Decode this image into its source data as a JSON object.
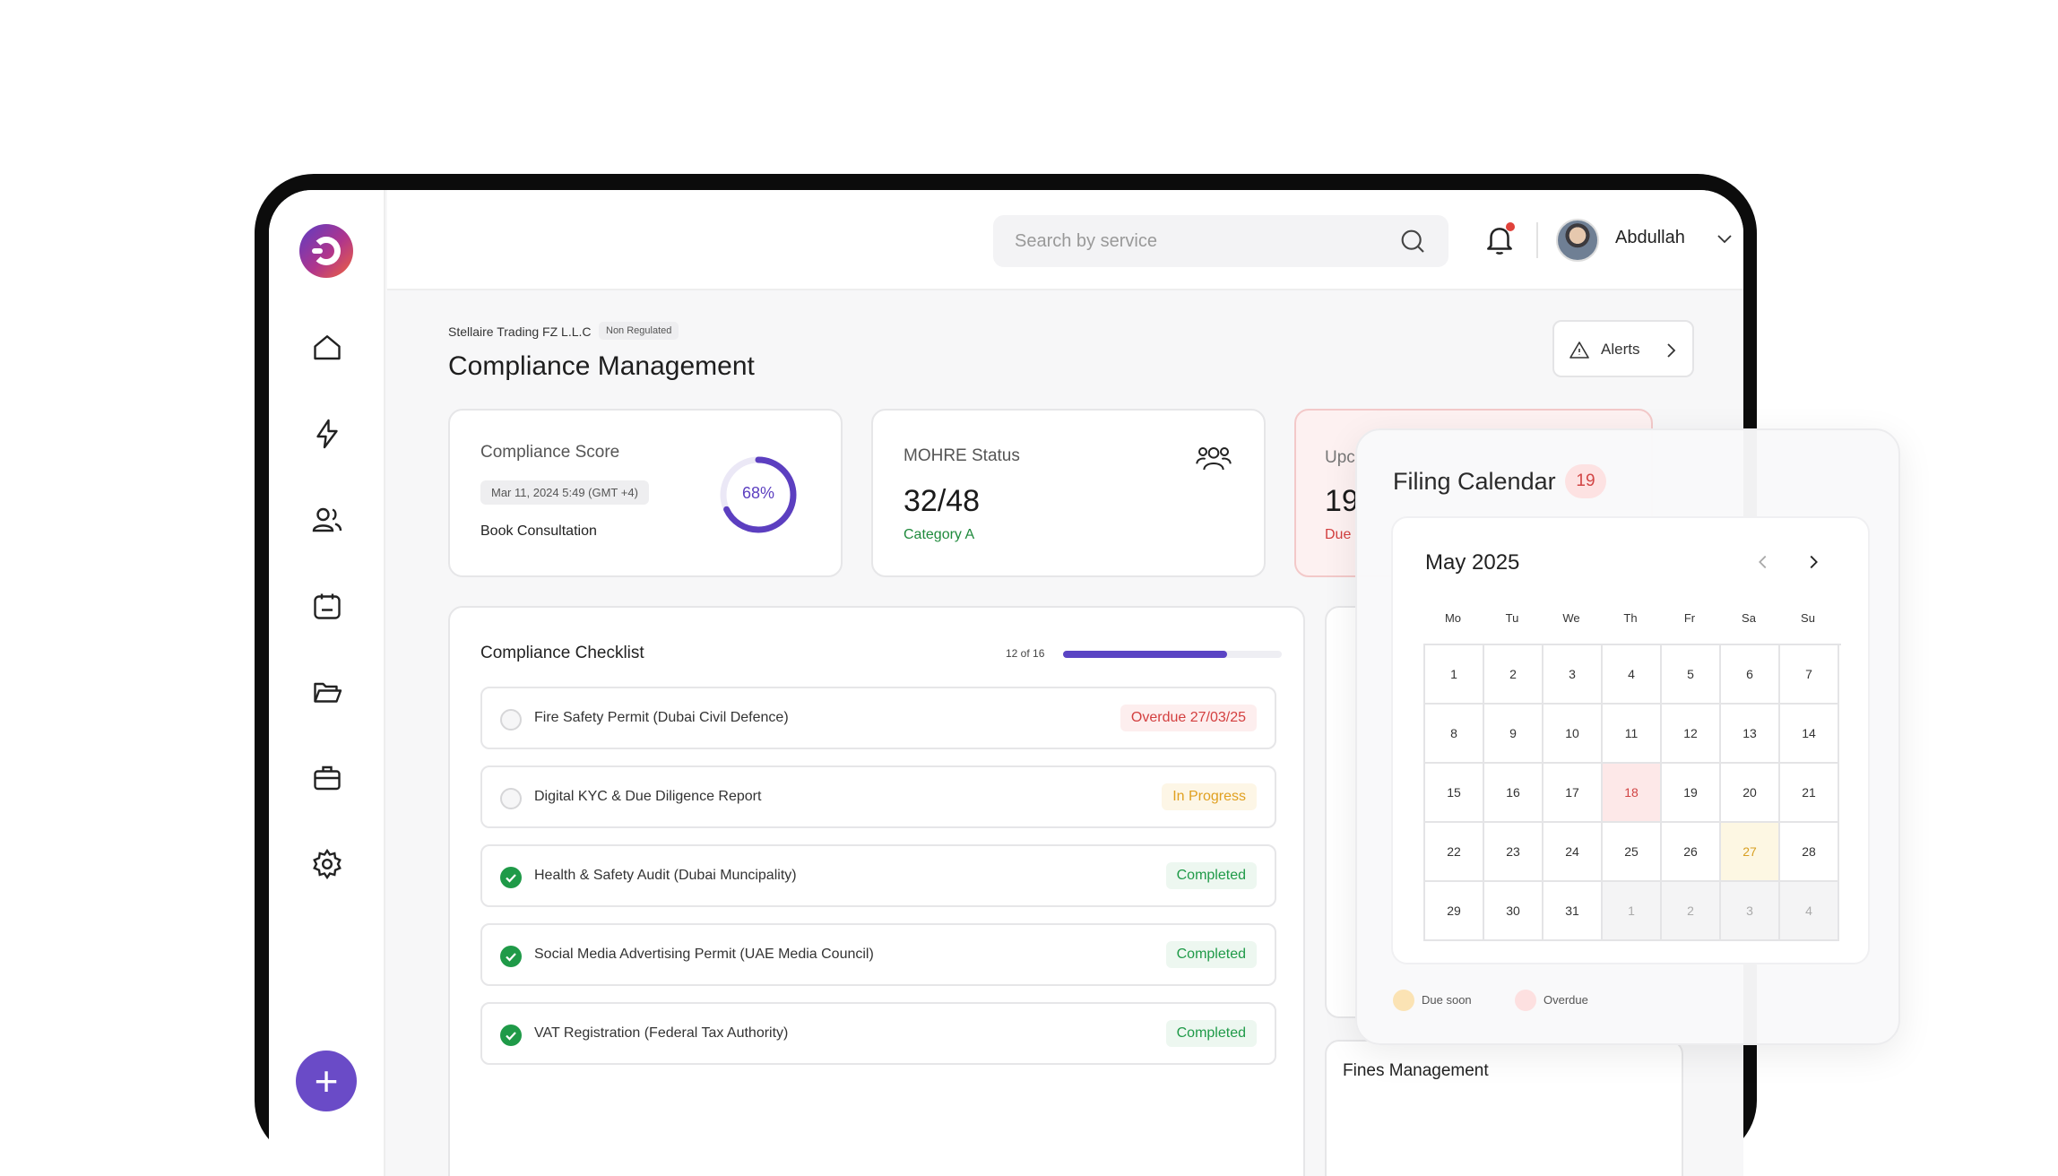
{
  "header": {
    "search_placeholder": "Search by service",
    "user_name": "Abdullah"
  },
  "page": {
    "company": "Stellaire Trading FZ L.L.C",
    "company_badge": "Non Regulated",
    "title": "Compliance Management",
    "alerts_label": "Alerts"
  },
  "score_card": {
    "label": "Compliance Score",
    "date": "Mar 11, 2024 5:49 (GMT +4)",
    "action": "Book Consultation",
    "percent_text": "68%",
    "percent_value": 68
  },
  "mohre_card": {
    "label": "MOHRE Status",
    "value": "32/48",
    "category": "Category A"
  },
  "upcoming_card": {
    "label": "Upc",
    "value": "19",
    "sub": "Due"
  },
  "checklist": {
    "title": "Compliance Checklist",
    "progress_text": "12 of 16",
    "progress_done": 12,
    "progress_total": 16,
    "items": [
      {
        "text": "Fire Safety Permit (Dubai Civil Defence)",
        "status": "Overdue 27/03/25",
        "kind": "overdue",
        "done": false
      },
      {
        "text": "Digital KYC & Due Diligence Report",
        "status": "In Progress",
        "kind": "progress",
        "done": false
      },
      {
        "text": "Health & Safety Audit (Dubai Muncipality)",
        "status": "Completed",
        "kind": "done",
        "done": true
      },
      {
        "text": "Social Media Advertising Permit (UAE Media Council)",
        "status": "Completed",
        "kind": "done",
        "done": true
      },
      {
        "text": "VAT Registration (Federal Tax Authority)",
        "status": "Completed",
        "kind": "done",
        "done": true
      }
    ]
  },
  "fines": {
    "title": "Fines Management"
  },
  "filing_calendar": {
    "title": "Filing Calendar",
    "count": "19",
    "month": "May 2025",
    "weekdays": [
      "Mo",
      "Tu",
      "We",
      "Th",
      "Fr",
      "Sa",
      "Su"
    ],
    "weeks": [
      [
        {
          "d": "1"
        },
        {
          "d": "2"
        },
        {
          "d": "3"
        },
        {
          "d": "4"
        },
        {
          "d": "5"
        },
        {
          "d": "6"
        },
        {
          "d": "7"
        }
      ],
      [
        {
          "d": "8"
        },
        {
          "d": "9"
        },
        {
          "d": "10"
        },
        {
          "d": "11"
        },
        {
          "d": "12"
        },
        {
          "d": "13"
        },
        {
          "d": "14"
        }
      ],
      [
        {
          "d": "15"
        },
        {
          "d": "16"
        },
        {
          "d": "17"
        },
        {
          "d": "18",
          "state": "overdue"
        },
        {
          "d": "19"
        },
        {
          "d": "20"
        },
        {
          "d": "21"
        }
      ],
      [
        {
          "d": "22"
        },
        {
          "d": "23"
        },
        {
          "d": "24"
        },
        {
          "d": "25"
        },
        {
          "d": "26"
        },
        {
          "d": "27",
          "state": "due-soon"
        },
        {
          "d": "28"
        }
      ],
      [
        {
          "d": "29"
        },
        {
          "d": "30"
        },
        {
          "d": "31"
        },
        {
          "d": "1",
          "state": "other"
        },
        {
          "d": "2",
          "state": "other"
        },
        {
          "d": "3",
          "state": "other"
        },
        {
          "d": "4",
          "state": "other"
        }
      ]
    ],
    "legend": [
      {
        "label": "Due soon",
        "color": "#fbe3b4"
      },
      {
        "label": "Overdue",
        "color": "#fde0e0"
      }
    ]
  },
  "colors": {
    "accent": "#5a44c4",
    "overdue": "#d33f3f",
    "completed": "#1f9a48",
    "in_progress": "#e0a020"
  }
}
